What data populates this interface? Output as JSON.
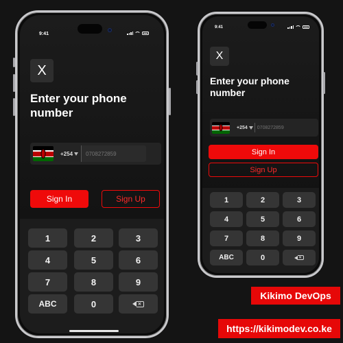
{
  "status": {
    "time": "9:41"
  },
  "screen": {
    "close_label": "X",
    "title_line1": "Enter your phone",
    "title_line2": "number",
    "country_code": "+254",
    "phone_placeholder": "0708272859",
    "sign_in_label": "Sign In",
    "sign_up_label": "Sign Up"
  },
  "keypad": {
    "k1": "1",
    "k2": "2",
    "k3": "3",
    "k4": "4",
    "k5": "5",
    "k6": "6",
    "k7": "7",
    "k8": "8",
    "k9": "9",
    "abc": "ABC",
    "k0": "0"
  },
  "badges": {
    "brand": "Kikimo DevOps",
    "url": "https://kikimodev.co.ke"
  },
  "colors": {
    "accent": "#ef0a0a",
    "background": "#141414",
    "key": "#353535"
  }
}
